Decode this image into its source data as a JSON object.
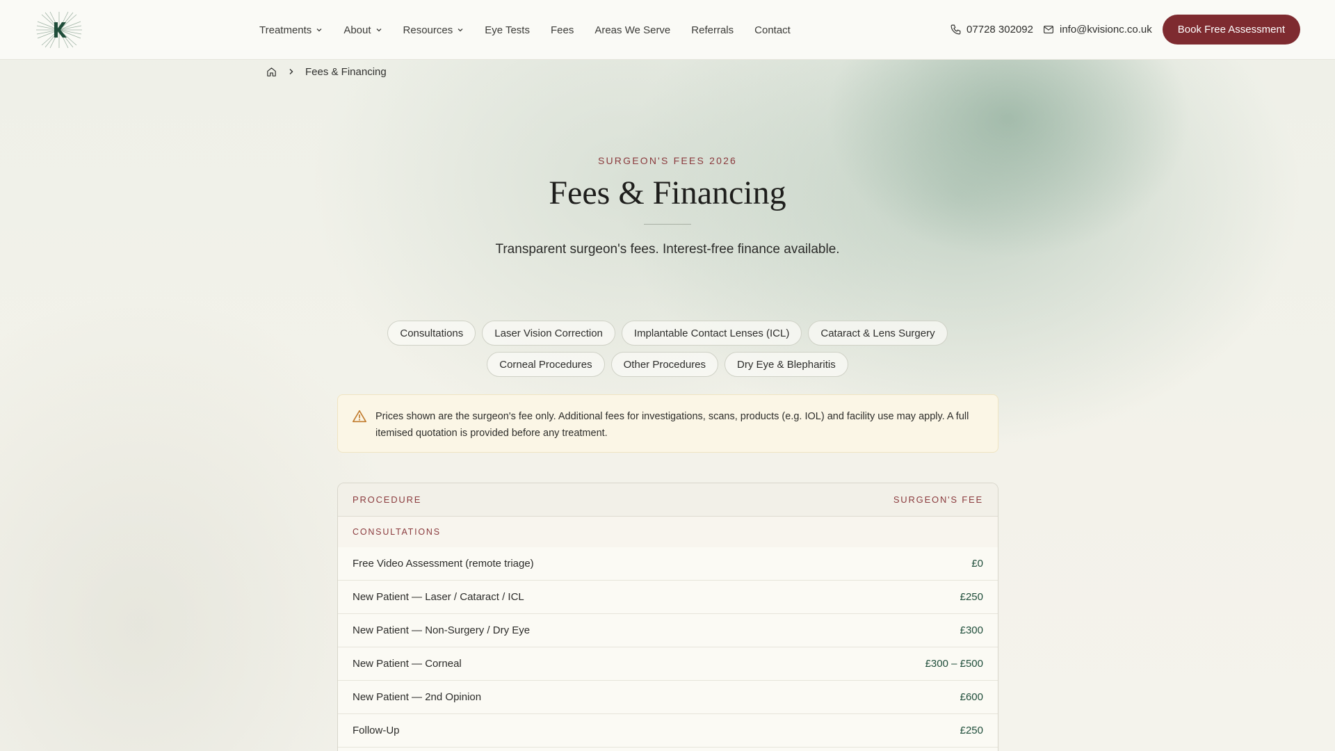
{
  "nav": {
    "items": [
      {
        "label": "Treatments",
        "dropdown": true
      },
      {
        "label": "About",
        "dropdown": true
      },
      {
        "label": "Resources",
        "dropdown": true
      },
      {
        "label": "Eye Tests",
        "dropdown": false
      },
      {
        "label": "Fees",
        "dropdown": false
      },
      {
        "label": "Areas We Serve",
        "dropdown": false
      },
      {
        "label": "Referrals",
        "dropdown": false
      },
      {
        "label": "Contact",
        "dropdown": false
      }
    ],
    "phone": "07728 302092",
    "email": "info@kvisionc.co.uk",
    "cta": "Book Free Assessment"
  },
  "breadcrumb": {
    "home_icon": "home-icon",
    "current": "Fees & Financing"
  },
  "hero": {
    "eyebrow": "SURGEON'S FEES 2026",
    "title": "Fees & Financing",
    "subtitle": "Transparent surgeon's fees. Interest-free finance available."
  },
  "filters": {
    "row1": [
      "Consultations",
      "Laser Vision Correction",
      "Implantable Contact Lenses (ICL)",
      "Cataract & Lens Surgery"
    ],
    "row2": [
      "Corneal Procedures",
      "Other Procedures",
      "Dry Eye & Blepharitis"
    ]
  },
  "notice": {
    "icon": "warning-icon",
    "text": "Prices shown are the surgeon's fee only. Additional fees for investigations, scans, products (e.g. IOL) and facility use may apply. A full itemised quotation is provided before any treatment."
  },
  "table": {
    "headers": {
      "procedure": "PROCEDURE",
      "fee": "SURGEON'S FEE"
    },
    "group": "CONSULTATIONS",
    "rows": [
      {
        "procedure": "Free Video Assessment (remote triage)",
        "fee": "£0"
      },
      {
        "procedure": "New Patient — Laser / Cataract / ICL",
        "fee": "£250"
      },
      {
        "procedure": "New Patient — Non-Surgery / Dry Eye",
        "fee": "£300"
      },
      {
        "procedure": "New Patient — Corneal",
        "fee": "£300 – £500"
      },
      {
        "procedure": "New Patient — 2nd Opinion",
        "fee": "£600"
      },
      {
        "procedure": "Follow-Up",
        "fee": "£250"
      }
    ]
  },
  "colors": {
    "accent": "#7e2b30",
    "eyebrow": "#8a3a3d",
    "fee": "#1f4d3a",
    "brand_green": "#1f4d3a"
  }
}
